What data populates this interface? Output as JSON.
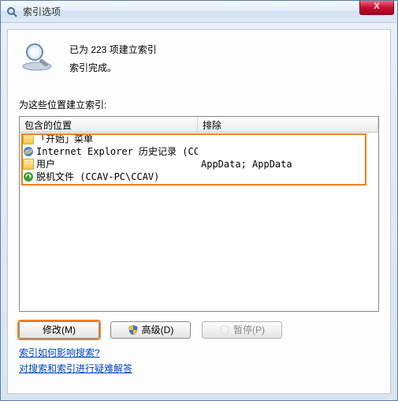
{
  "window": {
    "title": "索引选项",
    "close_glyph": "X"
  },
  "status": {
    "line1": "已为 223 项建立索引",
    "line2": "索引完成。"
  },
  "section_label": "为这些位置建立索引:",
  "columns": {
    "include": "包含的位置",
    "exclude": "排除"
  },
  "rows": [
    {
      "icon": "folder",
      "name": "「开始」菜单",
      "exclude": ""
    },
    {
      "icon": "ie",
      "name": "Internet Explorer 历史记录 (CCA...",
      "exclude": ""
    },
    {
      "icon": "folder",
      "name": "用户",
      "exclude": "AppData; AppData"
    },
    {
      "icon": "offline",
      "name": "脱机文件 (CCAV-PC\\CCAV)",
      "exclude": ""
    }
  ],
  "buttons": {
    "modify": "修改(M)",
    "advanced": "高级(D)",
    "pause": "暂停(P)"
  },
  "links": {
    "help": "索引如何影响搜索?",
    "troubleshoot": "对搜索和索引进行疑难解答"
  }
}
